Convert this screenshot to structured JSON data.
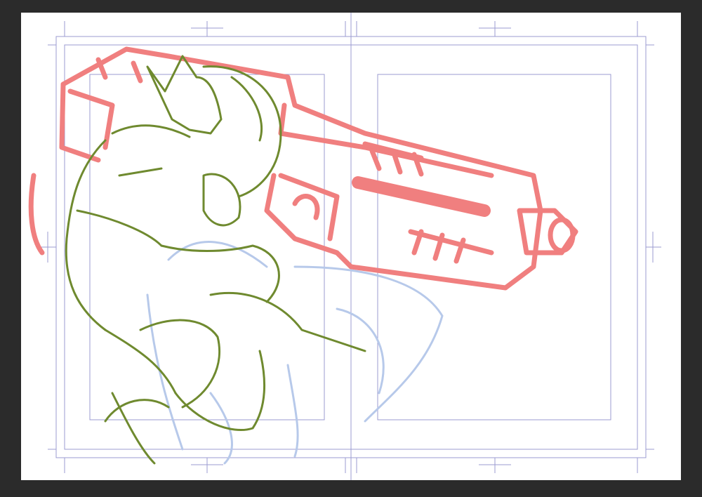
{
  "app": {
    "view": "manga-spread-canvas",
    "background_color": "#2b2b2b",
    "paper_color": "#ffffff"
  },
  "guides": {
    "color": "#9b9bd0",
    "show_trim_marks": true,
    "show_inner_frames": true,
    "spread_pages": 2
  },
  "layers": [
    {
      "name": "gun-sketch",
      "color": "#f07f7f"
    },
    {
      "name": "character-sketch",
      "color": "#6f8a2f"
    },
    {
      "name": "legs-sketch",
      "color": "#b7c9ea"
    }
  ]
}
